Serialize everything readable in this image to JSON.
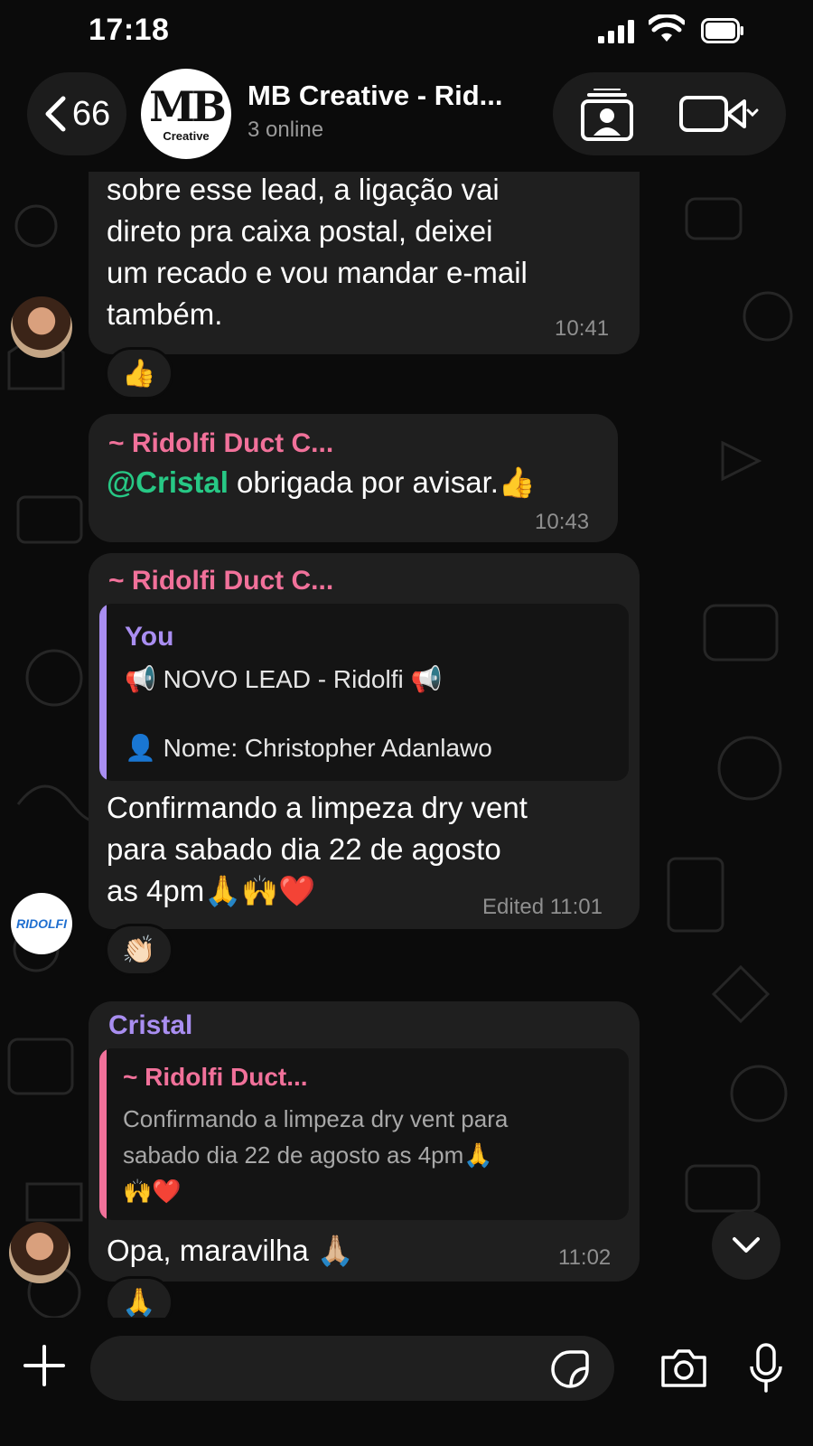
{
  "status_bar": {
    "time": "17:18"
  },
  "header": {
    "back_count": "66",
    "avatar_mark": "MB",
    "avatar_caption": "Creative",
    "title": "MB Creative - Rid...",
    "subtitle": "3 online"
  },
  "messages": [
    {
      "lines": [
        "sobre esse lead, a ligação vai",
        "direto pra caixa postal, deixei",
        "um recado e vou mandar e-mail",
        "também."
      ],
      "time": "10:41",
      "reaction": "👍"
    },
    {
      "sender": "~ Ridolfi Duct C...",
      "mention": "@Cristal",
      "text": " obrigada por avisar.👍",
      "time": "10:43"
    },
    {
      "sender": "~ Ridolfi Duct C...",
      "quote_author": "You",
      "quote_line1": "📢 NOVO LEAD - Ridolfi 📢",
      "quote_line2": "👤 Nome: Christopher Adanlawo",
      "lines": [
        "Confirmando a limpeza dry vent",
        "para sabado dia 22 de agosto",
        "as 4pm🙏🙌❤️"
      ],
      "time": "Edited 11:01",
      "reaction": "👏🏻",
      "avatar_logo": "RIDOLFI"
    },
    {
      "sender": "Cristal",
      "quote_author": "~ Ridolfi Duct...",
      "quote_lines": [
        "Confirmando a limpeza dry vent para",
        "sabado dia 22 de agosto as 4pm🙏",
        "🙌❤️"
      ],
      "text": "Opa, maravilha 🙏🏼",
      "time": "11:02",
      "reaction": "🙏"
    }
  ],
  "colors": {
    "background": "#0b0b0b",
    "bubble": "#1f1f1f",
    "sender_pink": "#f1719a",
    "sender_purple": "#a98ef1",
    "mention_green": "#27c885"
  },
  "icons": [
    "chevron-left-icon",
    "contact-card-icon",
    "video-camera-icon",
    "plus-icon",
    "sticker-icon",
    "camera-icon",
    "microphone-icon",
    "chevron-down-icon"
  ]
}
